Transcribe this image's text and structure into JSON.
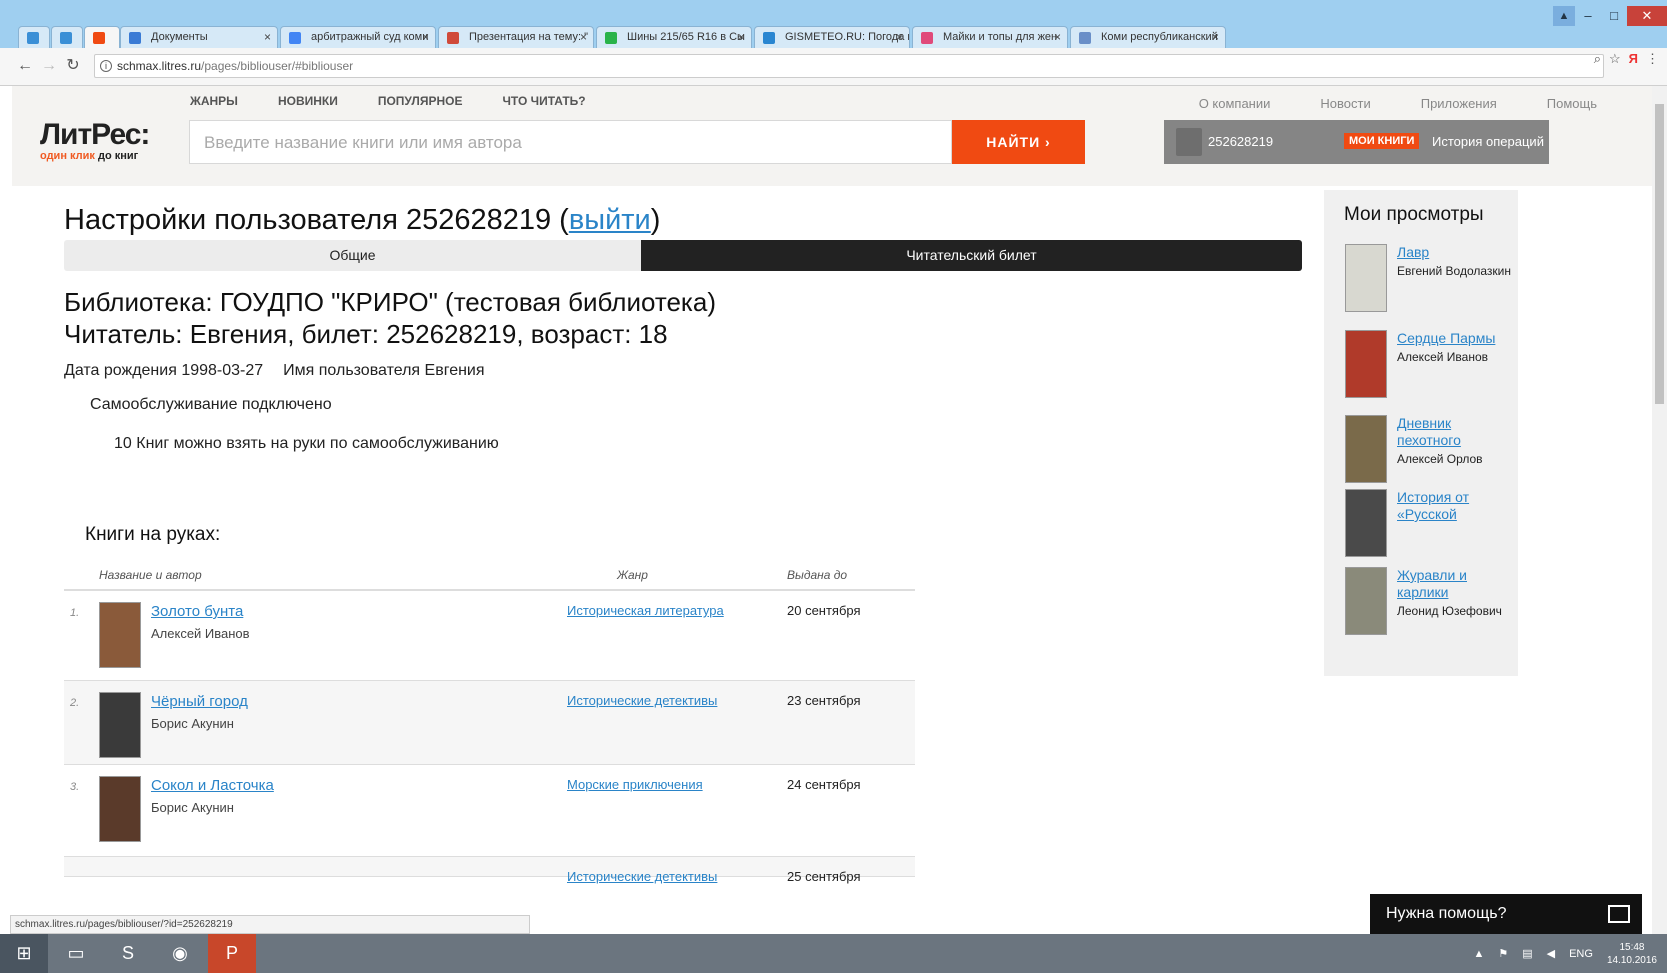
{
  "browser": {
    "tabs": [
      {
        "label": "",
        "pinned": true,
        "color": "#3a8fd6"
      },
      {
        "label": "",
        "pinned": true,
        "color": "#3a8fd6"
      },
      {
        "label": "",
        "pinned": true,
        "color": "#f04a12",
        "active": true
      },
      {
        "label": "Документы",
        "color": "#3a7bd5"
      },
      {
        "label": "арбитражный суд коми",
        "color": "#4285f4"
      },
      {
        "label": "Презентация на тему: \"",
        "color": "#d04a3a"
      },
      {
        "label": "Шины 215/65 R16 в Сы",
        "color": "#2ab34a"
      },
      {
        "label": "GISMETEO.RU: Погода в",
        "color": "#2a86d1"
      },
      {
        "label": "Майки и топы для жен",
        "color": "#e04a7a"
      },
      {
        "label": "Коми республиканский",
        "color": "#6a8fc8"
      }
    ],
    "url_host": "schmax.litres.ru",
    "url_path": "/pages/bibliouser/#bibliouser",
    "ya": "Я",
    "status_url": "schmax.litres.ru/pages/bibliouser/?id=252628219"
  },
  "site": {
    "logo_main": "ЛитРес:",
    "logo_sub_1": "один клик",
    "logo_sub_2": "до книг",
    "topnav": [
      "ЖАНРЫ",
      "НОВИНКИ",
      "ПОПУЛЯРНОЕ",
      "ЧТО ЧИТАТЬ?"
    ],
    "rightnav": [
      "О компании",
      "Новости",
      "Приложения",
      "Помощь"
    ],
    "search_placeholder": "Введите название книги или имя автора",
    "search_button": "НАЙТИ",
    "user_id": "252628219",
    "my_books": "МОИ КНИГИ",
    "history": "История операций"
  },
  "main": {
    "title_prefix": "Настройки пользователя 252628219 (",
    "logout": "выйти",
    "title_suffix": ")",
    "tab_general": "Общие",
    "tab_card": "Читательский билет",
    "library_line": "Библиотека: ГОУДПО \"КРИРО\" (тестовая библиотека)",
    "reader_line": "Читатель: Евгения, билет: 252628219, возраст: 18",
    "birth_date": "Дата рождения 1998-03-27",
    "username": "Имя пользователя Евгения",
    "self_service": "Самообслуживание подключено",
    "books_limit": "10 Книг можно взять на руки по самообслуживанию",
    "on_hands_title": "Книги на руках:",
    "col_title": "Название и автор",
    "col_genre": "Жанр",
    "col_due": "Выдана до",
    "rows": [
      {
        "num": "1.",
        "title": "Золото бунта",
        "author": "Алексей Иванов",
        "genre": "Историческая литература",
        "due": "20 сентября",
        "cover": "#8a5a3a"
      },
      {
        "num": "2.",
        "title": "Чёрный город",
        "author": "Борис Акунин",
        "genre": "Исторические детективы",
        "due": "23 сентября",
        "cover": "#3a3a3a"
      },
      {
        "num": "3.",
        "title": "Сокол и Ласточка",
        "author": "Борис Акунин",
        "genre": "Морские приключения",
        "due": "24 сентября",
        "cover": "#5a3a2a"
      },
      {
        "num": "",
        "title": "",
        "author": "",
        "genre": "Исторические детективы",
        "due": "25 сентября",
        "cover": "#fff"
      }
    ]
  },
  "sidebar": {
    "title": "Мои просмотры",
    "items": [
      {
        "title": "Лавр",
        "author": "Евгений Водолазкин",
        "cover": "#d8d8d0"
      },
      {
        "title": "Сердце Пармы",
        "author": "Алексей Иванов",
        "cover": "#b03a2a"
      },
      {
        "title": "Дневник пехотного",
        "author": "Алексей Орлов",
        "cover": "#7a6a4a"
      },
      {
        "title": "История от «Русской",
        "author": "",
        "cover": "#4a4a4a"
      },
      {
        "title": "Журавли и карлики",
        "author": "Леонид Юзефович",
        "cover": "#8a8a7a"
      }
    ]
  },
  "help": "Нужна помощь?",
  "taskbar": {
    "lang": "ENG",
    "time": "15:48",
    "date": "14.10.2016"
  }
}
